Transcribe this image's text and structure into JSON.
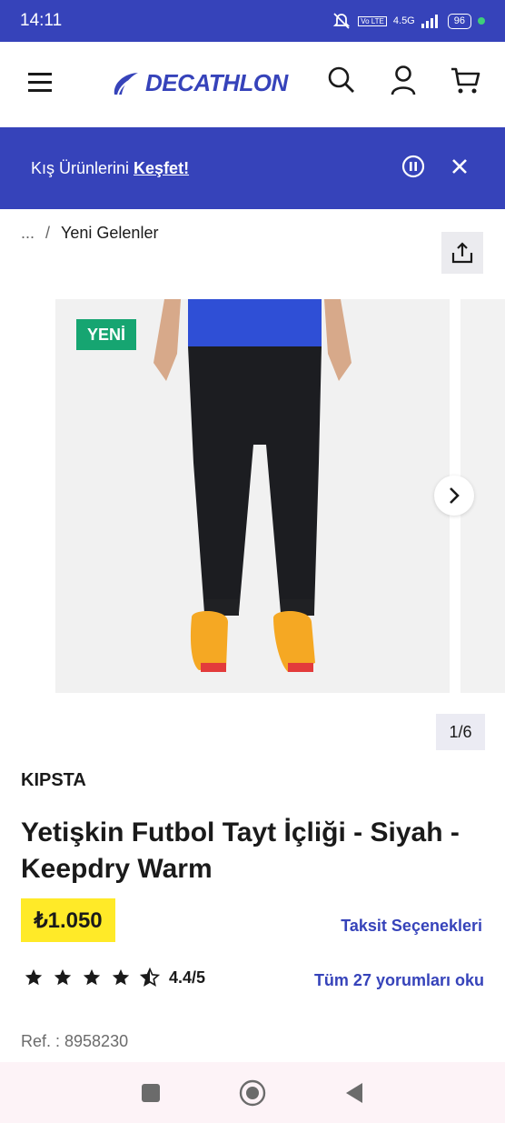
{
  "status_bar": {
    "time": "14:11",
    "network": "4.5G",
    "volte": "Vo LTE",
    "battery": "96"
  },
  "header": {
    "logo_text": "DECATHLON",
    "icons": [
      "menu-icon",
      "search-icon",
      "account-icon",
      "cart-icon"
    ]
  },
  "promo": {
    "text": "Kış Ürünlerini",
    "link": "Keşfet!"
  },
  "breadcrumb": {
    "ellipsis": "...",
    "separator": "/",
    "current": "Yeni Gelenler"
  },
  "gallery": {
    "badge": "YENİ",
    "counter": "1/6"
  },
  "product": {
    "brand": "KIPSTA",
    "title": "Yetişkin Futbol Tayt İçliği - Siyah - Keepdry Warm",
    "price": "₺1.050",
    "installment_link": "Taksit Seçenekleri",
    "rating": 4.4,
    "rating_text": "4.4/5",
    "reviews_link": "Tüm 27 yorumları oku",
    "ref": "Ref. : 8958230"
  },
  "colors": {
    "brand_blue": "#3643ba",
    "price_yellow": "#ffea28",
    "badge_green": "#16a571"
  }
}
